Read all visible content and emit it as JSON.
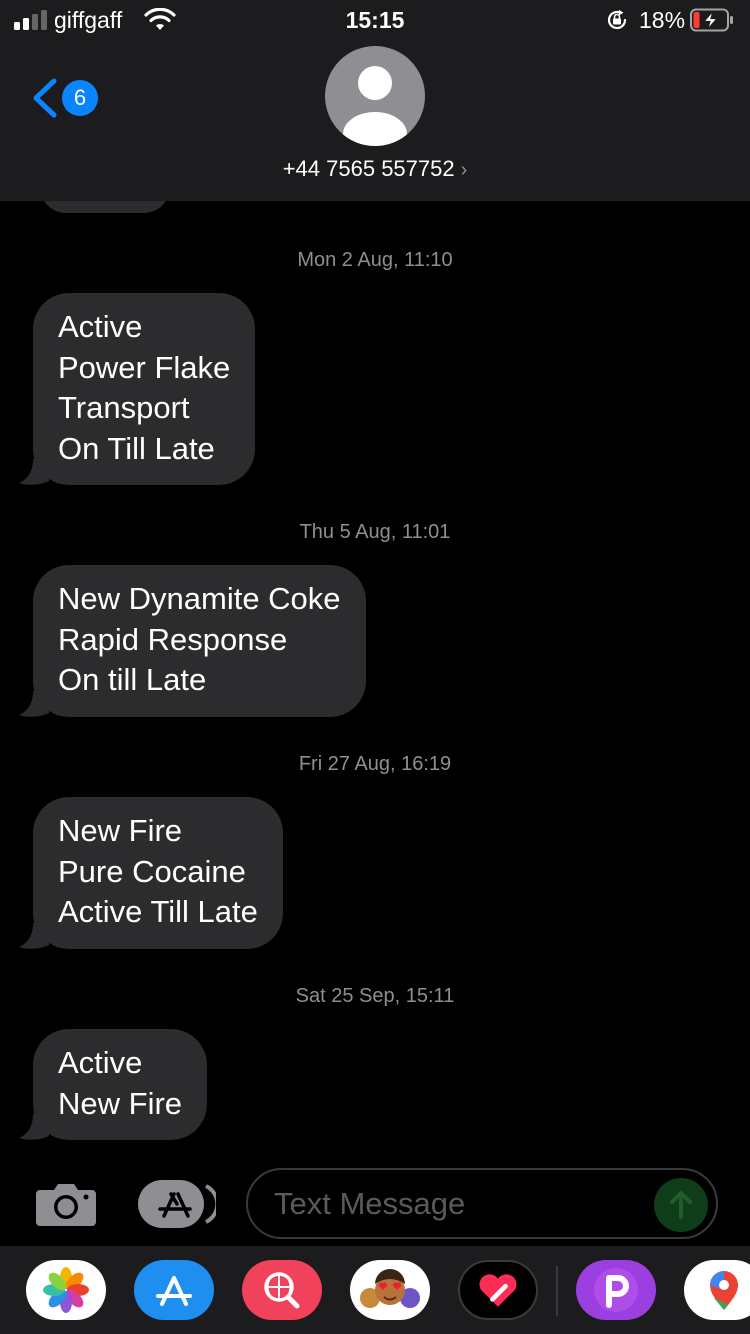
{
  "status_bar": {
    "carrier": "giffgaff",
    "time": "15:15",
    "battery_percent": "18%",
    "battery_level": 0.18,
    "charging": true,
    "icons": [
      "signal-icon",
      "wifi-icon",
      "rotation-lock-icon",
      "battery-icon"
    ]
  },
  "nav": {
    "back_badge": "6",
    "contact_name": "+44 7565 557752",
    "contact_chevron": "›"
  },
  "messages": [
    {
      "timestamp": "Mon 2 Aug, 11:10",
      "lines": [
        "Active",
        "Power Flake",
        "Transport",
        "On Till Late"
      ]
    },
    {
      "timestamp": "Thu 5 Aug, 11:01",
      "lines": [
        "New Dynamite Coke",
        "Rapid Response",
        "On till Late"
      ]
    },
    {
      "timestamp": "Fri 27 Aug, 16:19",
      "lines": [
        "New Fire",
        "Pure Cocaine",
        "Active Till Late"
      ]
    },
    {
      "timestamp": "Sat 25 Sep, 15:11",
      "lines": [
        "Active",
        "New Fire"
      ]
    }
  ],
  "composer": {
    "placeholder": "Text Message",
    "icons": [
      "camera-icon",
      "app-store-icon",
      "send-arrow-icon"
    ]
  },
  "app_drawer": {
    "apps": [
      "photos-app-icon",
      "app-store-app-icon",
      "web-search-app-icon",
      "memoji-stickers-app-icon",
      "digital-touch-app-icon",
      "picsart-app-icon",
      "google-maps-app-icon"
    ]
  },
  "colors": {
    "accent": "#0a84ff",
    "bubble_received": "#2c2c2e",
    "background": "#000000",
    "header": "#1c1c1e",
    "timestamp": "#8e8e93",
    "battery_low": "#ff3b30"
  }
}
